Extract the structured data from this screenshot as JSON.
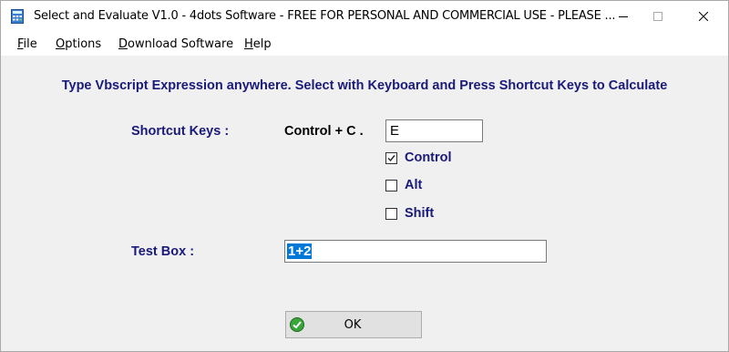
{
  "window": {
    "title": "Select and Evaluate V1.0 - 4dots Software - FREE FOR PERSONAL AND COMMERCIAL USE - PLEASE ...",
    "icon": "calculator-icon"
  },
  "menu": [
    {
      "label": "File",
      "underline": "F",
      "rest": "ile"
    },
    {
      "label": "Options",
      "underline": "O",
      "rest": "ptions"
    },
    {
      "label": "Download Software",
      "underline": "D",
      "rest": "ownload Software"
    },
    {
      "label": "Help",
      "underline": "H",
      "rest": "elp"
    }
  ],
  "headline": "Type Vbscript Expression anywhere. Select with Keyboard and Press Shortcut Keys to Calculate",
  "shortcut": {
    "label": "Shortcut Keys :",
    "current": "Control + C .",
    "key_value": "E",
    "control_label": "Control",
    "control_checked": true,
    "alt_label": "Alt",
    "alt_checked": false,
    "shift_label": "Shift",
    "shift_checked": false
  },
  "test": {
    "label": "Test Box :",
    "value": "1+2"
  },
  "ok_button": {
    "label": "OK",
    "icon": "green-check-icon"
  },
  "colors": {
    "label_blue": "#1a1a7a",
    "selection": "#0078d7"
  }
}
